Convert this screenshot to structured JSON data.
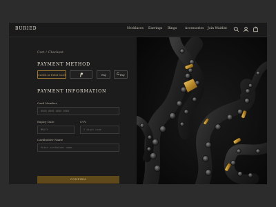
{
  "brand": "BURIED",
  "nav": {
    "items": [
      "Necklaces",
      "Earrings",
      "Rings",
      "Accessories",
      "Join Waitlist"
    ],
    "icons": [
      "search-icon",
      "user-icon",
      "bag-icon"
    ]
  },
  "breadcrumb": {
    "parent": "Cart",
    "separator": "/",
    "current": "Checkout"
  },
  "payment_method": {
    "title": "PAYMENT METHOD",
    "options": [
      {
        "label": "Credit or Debit Card",
        "active": true
      },
      {
        "label": "PayPal",
        "active": false
      },
      {
        "label": "Pay",
        "glyph": "",
        "active": false
      },
      {
        "label": "Pay",
        "glyph": "G",
        "active": false
      }
    ]
  },
  "payment_info": {
    "title": "PAYMENT INFORMATION",
    "card_number": {
      "label": "Card Number",
      "placeholder": "0000 0000 0000 0000"
    },
    "expiry": {
      "label": "Expiry Date",
      "placeholder": "MM/YY"
    },
    "cvv": {
      "label": "CVV",
      "placeholder": "3 digit code"
    },
    "holder": {
      "label": "Cardholder Name",
      "placeholder": "Enter cardholder name"
    }
  },
  "confirm_label": "CONFIRM",
  "colors": {
    "accent": "#a27c36",
    "button": "#5f4819",
    "background": "#1b1b1b"
  }
}
